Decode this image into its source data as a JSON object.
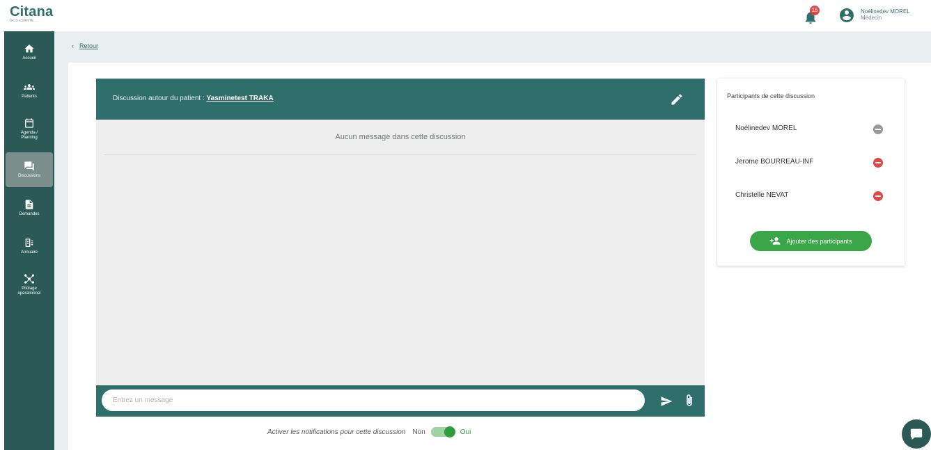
{
  "app": {
    "logo": "Citana",
    "logo_sub": "GCS eSANTE ..."
  },
  "header": {
    "notification_count": "15",
    "user_name": "Noélinedev MOREL",
    "user_role": "Médecin"
  },
  "sidebar": {
    "items": [
      {
        "label": "Accueil",
        "icon": "home-icon"
      },
      {
        "label": "Patients",
        "icon": "patients-icon"
      },
      {
        "label": "Agenda / Planning",
        "icon": "calendar-icon"
      },
      {
        "label": "Discussions",
        "icon": "chat-icon",
        "active": true
      },
      {
        "label": "Demandes",
        "icon": "document-icon"
      },
      {
        "label": "Annuaire",
        "icon": "directory-icon"
      },
      {
        "label": "Pilotage opérationnel",
        "icon": "network-icon"
      }
    ]
  },
  "breadcrumb": {
    "back_label": "Retour"
  },
  "chat": {
    "header_prefix": "Discussion autour du patient : ",
    "patient_name": "Yasminetest TRAKA",
    "empty_message": "Aucun message dans cette discussion",
    "input_placeholder": "Entrez un message"
  },
  "notifications": {
    "label": "Activer les notifications pour cette discussion",
    "off_label": "Non",
    "on_label": "Oui",
    "enabled": true
  },
  "participants": {
    "title": "Participants de cette discussion",
    "list": [
      {
        "name": "Noélinedev MOREL",
        "removable": false
      },
      {
        "name": "Jerome BOURREAU-INF",
        "removable": true
      },
      {
        "name": "Christelle NEVAT",
        "removable": true
      }
    ],
    "add_label": "Ajouter des participants"
  },
  "colors": {
    "primary": "#2f6f6b",
    "sidebar": "#2b5a56",
    "accent_green": "#3aa648",
    "danger": "#e04848",
    "disabled": "#9a9a9a"
  }
}
